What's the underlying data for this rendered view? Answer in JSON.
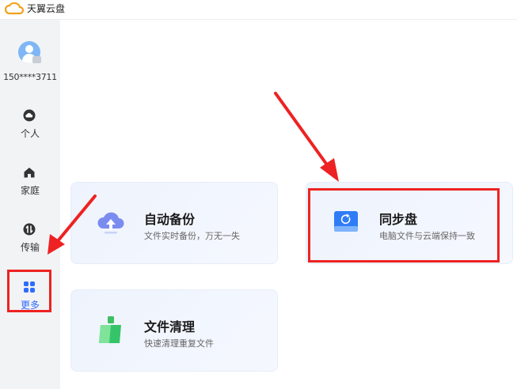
{
  "app": {
    "title": "天翼云盘"
  },
  "sidebar": {
    "user": {
      "phone": "150****3711"
    },
    "items": [
      {
        "label": "个人",
        "icon": "cloud-icon"
      },
      {
        "label": "家庭",
        "icon": "home-icon"
      },
      {
        "label": "传输",
        "icon": "transfer-icon"
      },
      {
        "label": "更多",
        "icon": "grid-icon",
        "active": true
      }
    ]
  },
  "cards": [
    {
      "title": "自动备份",
      "desc": "文件实时备份，万无一失",
      "icon": "cloud-upload-icon"
    },
    {
      "title": "同步盘",
      "desc": "电脑文件与云端保持一致",
      "icon": "sync-disk-icon"
    },
    {
      "title": "文件清理",
      "desc": "快速清理重复文件",
      "icon": "broom-icon"
    }
  ],
  "colors": {
    "accent": "#2f6bff",
    "highlight": "#ee2222",
    "sidebar_bg": "#f2f3f5"
  }
}
